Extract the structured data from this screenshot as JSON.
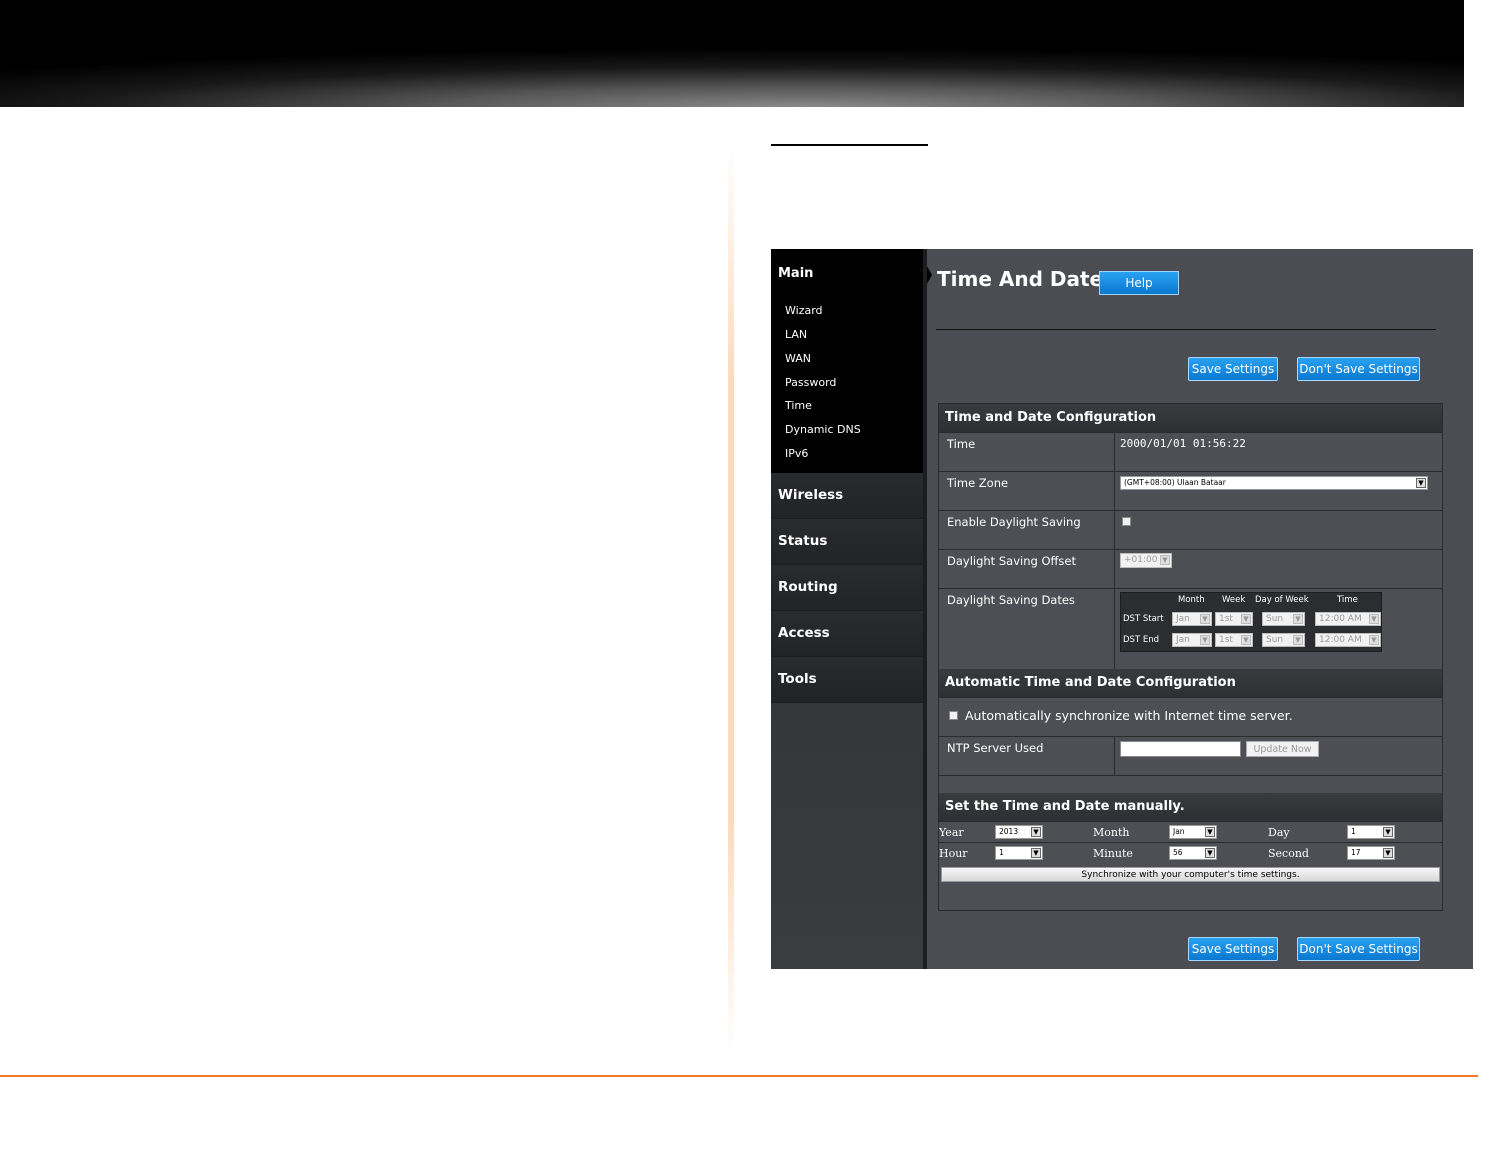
{
  "sidebar": {
    "main_title": "Main",
    "main_items": [
      "Wizard",
      "LAN",
      "WAN",
      "Password",
      "Time",
      "Dynamic DNS",
      "IPv6"
    ],
    "sections": [
      "Wireless",
      "Status",
      "Routing",
      "Access",
      "Tools"
    ]
  },
  "header": {
    "title": "Time And Date",
    "help_label": "Help"
  },
  "buttons": {
    "save": "Save Settings",
    "dont_save": "Don't Save Settings"
  },
  "time_config": {
    "heading": "Time and Date Configuration",
    "time_label": "Time",
    "time_value": "2000/01/01 01:56:22",
    "timezone_label": "Time Zone",
    "timezone_value": "(GMT+08:00) Ulaan Bataar",
    "daylight_label": "Enable Daylight Saving",
    "offset_label": "Daylight Saving Offset",
    "offset_value": "+01:00",
    "dates_label": "Daylight Saving Dates",
    "dst_headers": [
      "Month",
      "Week",
      "Day of Week",
      "Time"
    ],
    "dst_start_label": "DST Start",
    "dst_end_label": "DST End",
    "dst_start": [
      "Jan",
      "1st",
      "Sun",
      "12:00 AM"
    ],
    "dst_end": [
      "Jan",
      "1st",
      "Sun",
      "12:00 AM"
    ]
  },
  "auto_config": {
    "heading": "Automatic Time and Date Configuration",
    "sync_label": "Automatically synchronize with Internet time server.",
    "ntp_label": "NTP Server Used",
    "ntp_value": "",
    "update_label": "Update Now"
  },
  "manual": {
    "heading": "Set the Time and Date manually.",
    "year_label": "Year",
    "year_value": "2013",
    "month_label": "Month",
    "month_value": "Jan",
    "day_label": "Day",
    "day_value": "1",
    "hour_label": "Hour",
    "hour_value": "1",
    "minute_label": "Minute",
    "minute_value": "56",
    "second_label": "Second",
    "second_value": "17",
    "sync_computer_label": "Synchronize with your computer's time settings."
  }
}
